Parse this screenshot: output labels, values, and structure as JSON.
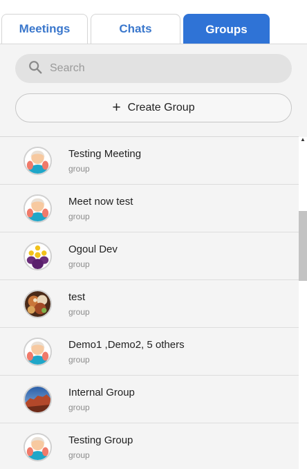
{
  "tabs": [
    {
      "label": "Meetings",
      "active": false
    },
    {
      "label": "Chats",
      "active": false
    },
    {
      "label": "Groups",
      "active": true
    }
  ],
  "search": {
    "placeholder": "Search",
    "icon": "search-icon"
  },
  "create_group": {
    "label": "Create Group",
    "icon": "plus-icon"
  },
  "groups": [
    {
      "name": "Testing Meeting",
      "type": "group",
      "avatar": "user-avatar-icon"
    },
    {
      "name": "Meet now test",
      "type": "group",
      "avatar": "user-avatar-icon"
    },
    {
      "name": "Ogoul Dev",
      "type": "group",
      "avatar": "team-avatar-icon"
    },
    {
      "name": "test",
      "type": "group",
      "avatar": "food-photo-avatar"
    },
    {
      "name": "Demo1 ,Demo2, 5 others",
      "type": "group",
      "avatar": "user-avatar-icon"
    },
    {
      "name": "Internal Group",
      "type": "group",
      "avatar": "landscape-photo-avatar"
    },
    {
      "name": "Testing Group",
      "type": "group",
      "avatar": "user-avatar-icon"
    }
  ],
  "colors": {
    "accent": "#2f73d6",
    "tab_text": "#3a77cc",
    "panel_bg": "#f4f4f4"
  }
}
